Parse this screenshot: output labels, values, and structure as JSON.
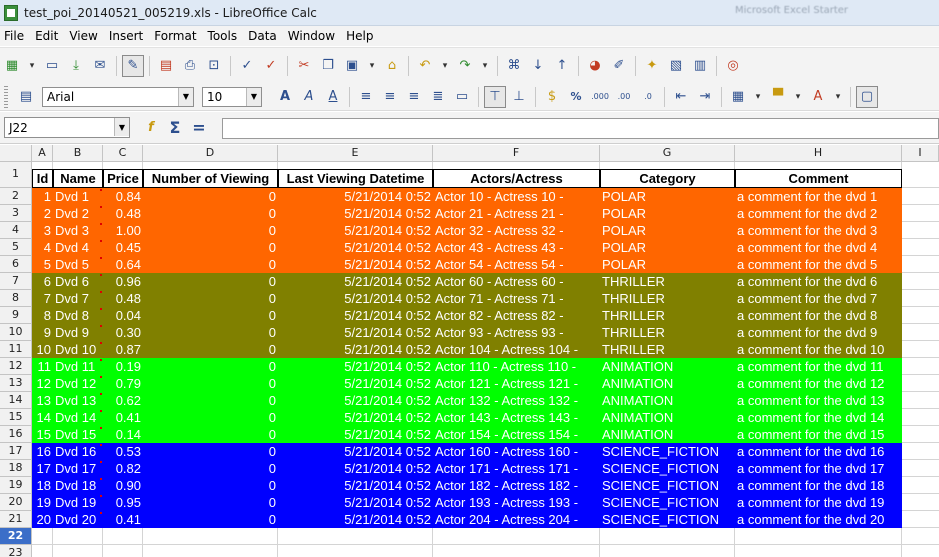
{
  "window": {
    "title": "test_poi_20140521_005219.xls - LibreOffice Calc",
    "ghost_title": "Microsoft Excel Starter"
  },
  "menu": [
    "File",
    "Edit",
    "View",
    "Insert",
    "Format",
    "Tools",
    "Data",
    "Window",
    "Help"
  ],
  "toolbar": {
    "font_name": "Arial",
    "font_size": "10"
  },
  "formula_bar": {
    "cell_ref": "J22",
    "formula": ""
  },
  "sheet": {
    "columns": [
      "A",
      "B",
      "C",
      "D",
      "E",
      "F",
      "G",
      "H",
      "I"
    ],
    "row_numbers": [
      "1",
      "2",
      "3",
      "4",
      "5",
      "6",
      "7",
      "8",
      "9",
      "10",
      "11",
      "12",
      "13",
      "14",
      "15",
      "16",
      "17",
      "18",
      "19",
      "20",
      "21",
      "22",
      "23"
    ],
    "selected_row": "22",
    "headers": [
      "Id",
      "Name",
      "Price",
      "Number of Viewing",
      "Last Viewing Datetime",
      "Actors/Actress",
      "Category",
      "Comment"
    ],
    "groups": [
      {
        "color": "#ff6600",
        "text_color": "#ffffff"
      },
      {
        "color": "#808000",
        "text_color": "#ffffff"
      },
      {
        "color": "#00ff00",
        "text_color": "#ffffff"
      },
      {
        "color": "#0000ff",
        "text_color": "#ffffff"
      }
    ],
    "rows": [
      {
        "id": "1",
        "name": "Dvd 1",
        "price": "0.84",
        "views": "0",
        "datetime": "5/21/2014 0:52",
        "actors": "Actor 10 - Actress 10 -",
        "category": "POLAR",
        "comment": "a comment for the dvd 1",
        "group": 0
      },
      {
        "id": "2",
        "name": "Dvd 2",
        "price": "0.48",
        "views": "0",
        "datetime": "5/21/2014 0:52",
        "actors": "Actor 21 - Actress 21 -",
        "category": "POLAR",
        "comment": "a comment for the dvd 2",
        "group": 0
      },
      {
        "id": "3",
        "name": "Dvd 3",
        "price": "1.00",
        "views": "0",
        "datetime": "5/21/2014 0:52",
        "actors": "Actor 32 - Actress 32 -",
        "category": "POLAR",
        "comment": "a comment for the dvd 3",
        "group": 0
      },
      {
        "id": "4",
        "name": "Dvd 4",
        "price": "0.45",
        "views": "0",
        "datetime": "5/21/2014 0:52",
        "actors": "Actor 43 - Actress 43 -",
        "category": "POLAR",
        "comment": "a comment for the dvd 4",
        "group": 0
      },
      {
        "id": "5",
        "name": "Dvd 5",
        "price": "0.64",
        "views": "0",
        "datetime": "5/21/2014 0:52",
        "actors": "Actor 54 - Actress 54 -",
        "category": "POLAR",
        "comment": "a comment for the dvd 5",
        "group": 0
      },
      {
        "id": "6",
        "name": "Dvd 6",
        "price": "0.96",
        "views": "0",
        "datetime": "5/21/2014 0:52",
        "actors": "Actor 60 - Actress 60 -",
        "category": "THRILLER",
        "comment": "a comment for the dvd 6",
        "group": 1
      },
      {
        "id": "7",
        "name": "Dvd 7",
        "price": "0.48",
        "views": "0",
        "datetime": "5/21/2014 0:52",
        "actors": "Actor 71 - Actress 71 -",
        "category": "THRILLER",
        "comment": "a comment for the dvd 7",
        "group": 1
      },
      {
        "id": "8",
        "name": "Dvd 8",
        "price": "0.04",
        "views": "0",
        "datetime": "5/21/2014 0:52",
        "actors": "Actor 82 - Actress 82 -",
        "category": "THRILLER",
        "comment": "a comment for the dvd 8",
        "group": 1
      },
      {
        "id": "9",
        "name": "Dvd 9",
        "price": "0.30",
        "views": "0",
        "datetime": "5/21/2014 0:52",
        "actors": "Actor 93 - Actress 93 -",
        "category": "THRILLER",
        "comment": "a comment for the dvd 9",
        "group": 1
      },
      {
        "id": "10",
        "name": "Dvd 10",
        "price": "0.87",
        "views": "0",
        "datetime": "5/21/2014 0:52",
        "actors": "Actor 104 - Actress 104 -",
        "category": "THRILLER",
        "comment": "a comment for the dvd 10",
        "group": 1
      },
      {
        "id": "11",
        "name": "Dvd 11",
        "price": "0.19",
        "views": "0",
        "datetime": "5/21/2014 0:52",
        "actors": "Actor 110 - Actress 110 -",
        "category": "ANIMATION",
        "comment": "a comment for the dvd 11",
        "group": 2
      },
      {
        "id": "12",
        "name": "Dvd 12",
        "price": "0.79",
        "views": "0",
        "datetime": "5/21/2014 0:52",
        "actors": "Actor 121 - Actress 121 -",
        "category": "ANIMATION",
        "comment": "a comment for the dvd 12",
        "group": 2
      },
      {
        "id": "13",
        "name": "Dvd 13",
        "price": "0.62",
        "views": "0",
        "datetime": "5/21/2014 0:52",
        "actors": "Actor 132 - Actress 132 -",
        "category": "ANIMATION",
        "comment": "a comment for the dvd 13",
        "group": 2
      },
      {
        "id": "14",
        "name": "Dvd 14",
        "price": "0.41",
        "views": "0",
        "datetime": "5/21/2014 0:52",
        "actors": "Actor 143 - Actress 143 -",
        "category": "ANIMATION",
        "comment": "a comment for the dvd 14",
        "group": 2
      },
      {
        "id": "15",
        "name": "Dvd 15",
        "price": "0.14",
        "views": "0",
        "datetime": "5/21/2014 0:52",
        "actors": "Actor 154 - Actress 154 -",
        "category": "ANIMATION",
        "comment": "a comment for the dvd 15",
        "group": 2
      },
      {
        "id": "16",
        "name": "Dvd 16",
        "price": "0.53",
        "views": "0",
        "datetime": "5/21/2014 0:52",
        "actors": "Actor 160 - Actress 160 -",
        "category": "SCIENCE_FICTION",
        "comment": "a comment for the dvd 16",
        "group": 3
      },
      {
        "id": "17",
        "name": "Dvd 17",
        "price": "0.82",
        "views": "0",
        "datetime": "5/21/2014 0:52",
        "actors": "Actor 171 - Actress 171 -",
        "category": "SCIENCE_FICTION",
        "comment": "a comment for the dvd 17",
        "group": 3
      },
      {
        "id": "18",
        "name": "Dvd 18",
        "price": "0.90",
        "views": "0",
        "datetime": "5/21/2014 0:52",
        "actors": "Actor 182 - Actress 182 -",
        "category": "SCIENCE_FICTION",
        "comment": "a comment for the dvd 18",
        "group": 3
      },
      {
        "id": "19",
        "name": "Dvd 19",
        "price": "0.95",
        "views": "0",
        "datetime": "5/21/2014 0:52",
        "actors": "Actor 193 - Actress 193 -",
        "category": "SCIENCE_FICTION",
        "comment": "a comment for the dvd 19",
        "group": 3
      },
      {
        "id": "20",
        "name": "Dvd 20",
        "price": "0.41",
        "views": "0",
        "datetime": "5/21/2014 0:52",
        "actors": "Actor 204 - Actress 204 -",
        "category": "SCIENCE_FICTION",
        "comment": "a comment for the dvd 20",
        "group": 3
      }
    ]
  }
}
